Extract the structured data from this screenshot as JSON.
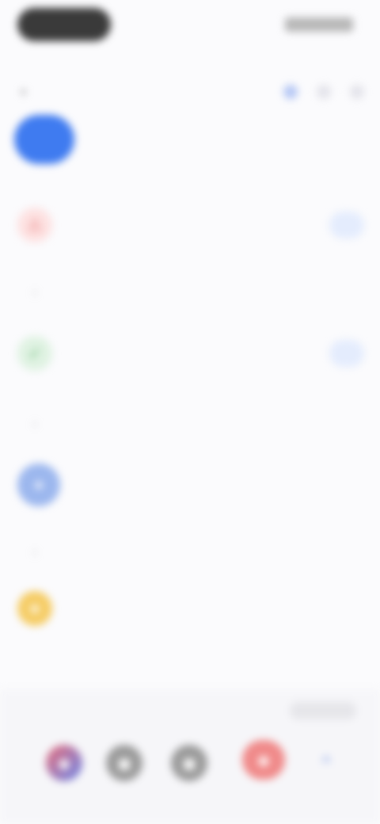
{
  "status_bar": {
    "time": "",
    "indicators": ""
  },
  "header": {
    "title": "",
    "title_chevron_icon": "chevron-down-icon",
    "actions": [
      {
        "icon": "plus-icon"
      },
      {
        "icon": "search-icon"
      },
      {
        "icon": "more-icon"
      }
    ]
  },
  "tabs": [
    {
      "label": "",
      "active": true
    },
    {
      "label": "",
      "active": false
    },
    {
      "label": "",
      "active": false
    }
  ],
  "sections": [
    {
      "id": "first",
      "header": "",
      "rows": [
        {
          "icon": "alert-icon",
          "icon_color": "#e46a6a",
          "title": "",
          "subtitle": "",
          "action": ""
        }
      ]
    },
    {
      "id": "second",
      "header": "",
      "rows": [
        {
          "icon": "check-icon",
          "icon_color": "#52b061",
          "title": "",
          "subtitle": "",
          "action": ""
        }
      ]
    },
    {
      "id": "third",
      "header": "",
      "rows": [
        {
          "icon": "avatar-icon",
          "icon_color": "#9cb7ee",
          "title": "",
          "subtitle": "",
          "meta": ""
        }
      ]
    },
    {
      "id": "fourth",
      "header": "",
      "rows": [
        {
          "icon": "star-icon",
          "icon_color": "#f5cc65",
          "title": "",
          "meta": ""
        }
      ]
    }
  ],
  "toolbar": {
    "labels": [
      "",
      "",
      "",
      ""
    ],
    "active_index": 3,
    "icons": [
      {
        "name": "app-icon-1"
      },
      {
        "name": "app-icon-2"
      },
      {
        "name": "app-icon-3"
      },
      {
        "name": "app-icon-4"
      },
      {
        "name": "chevron-up-icon"
      }
    ]
  },
  "colors": {
    "accent": "#3f7bf0",
    "background": "#fbfbfd"
  }
}
